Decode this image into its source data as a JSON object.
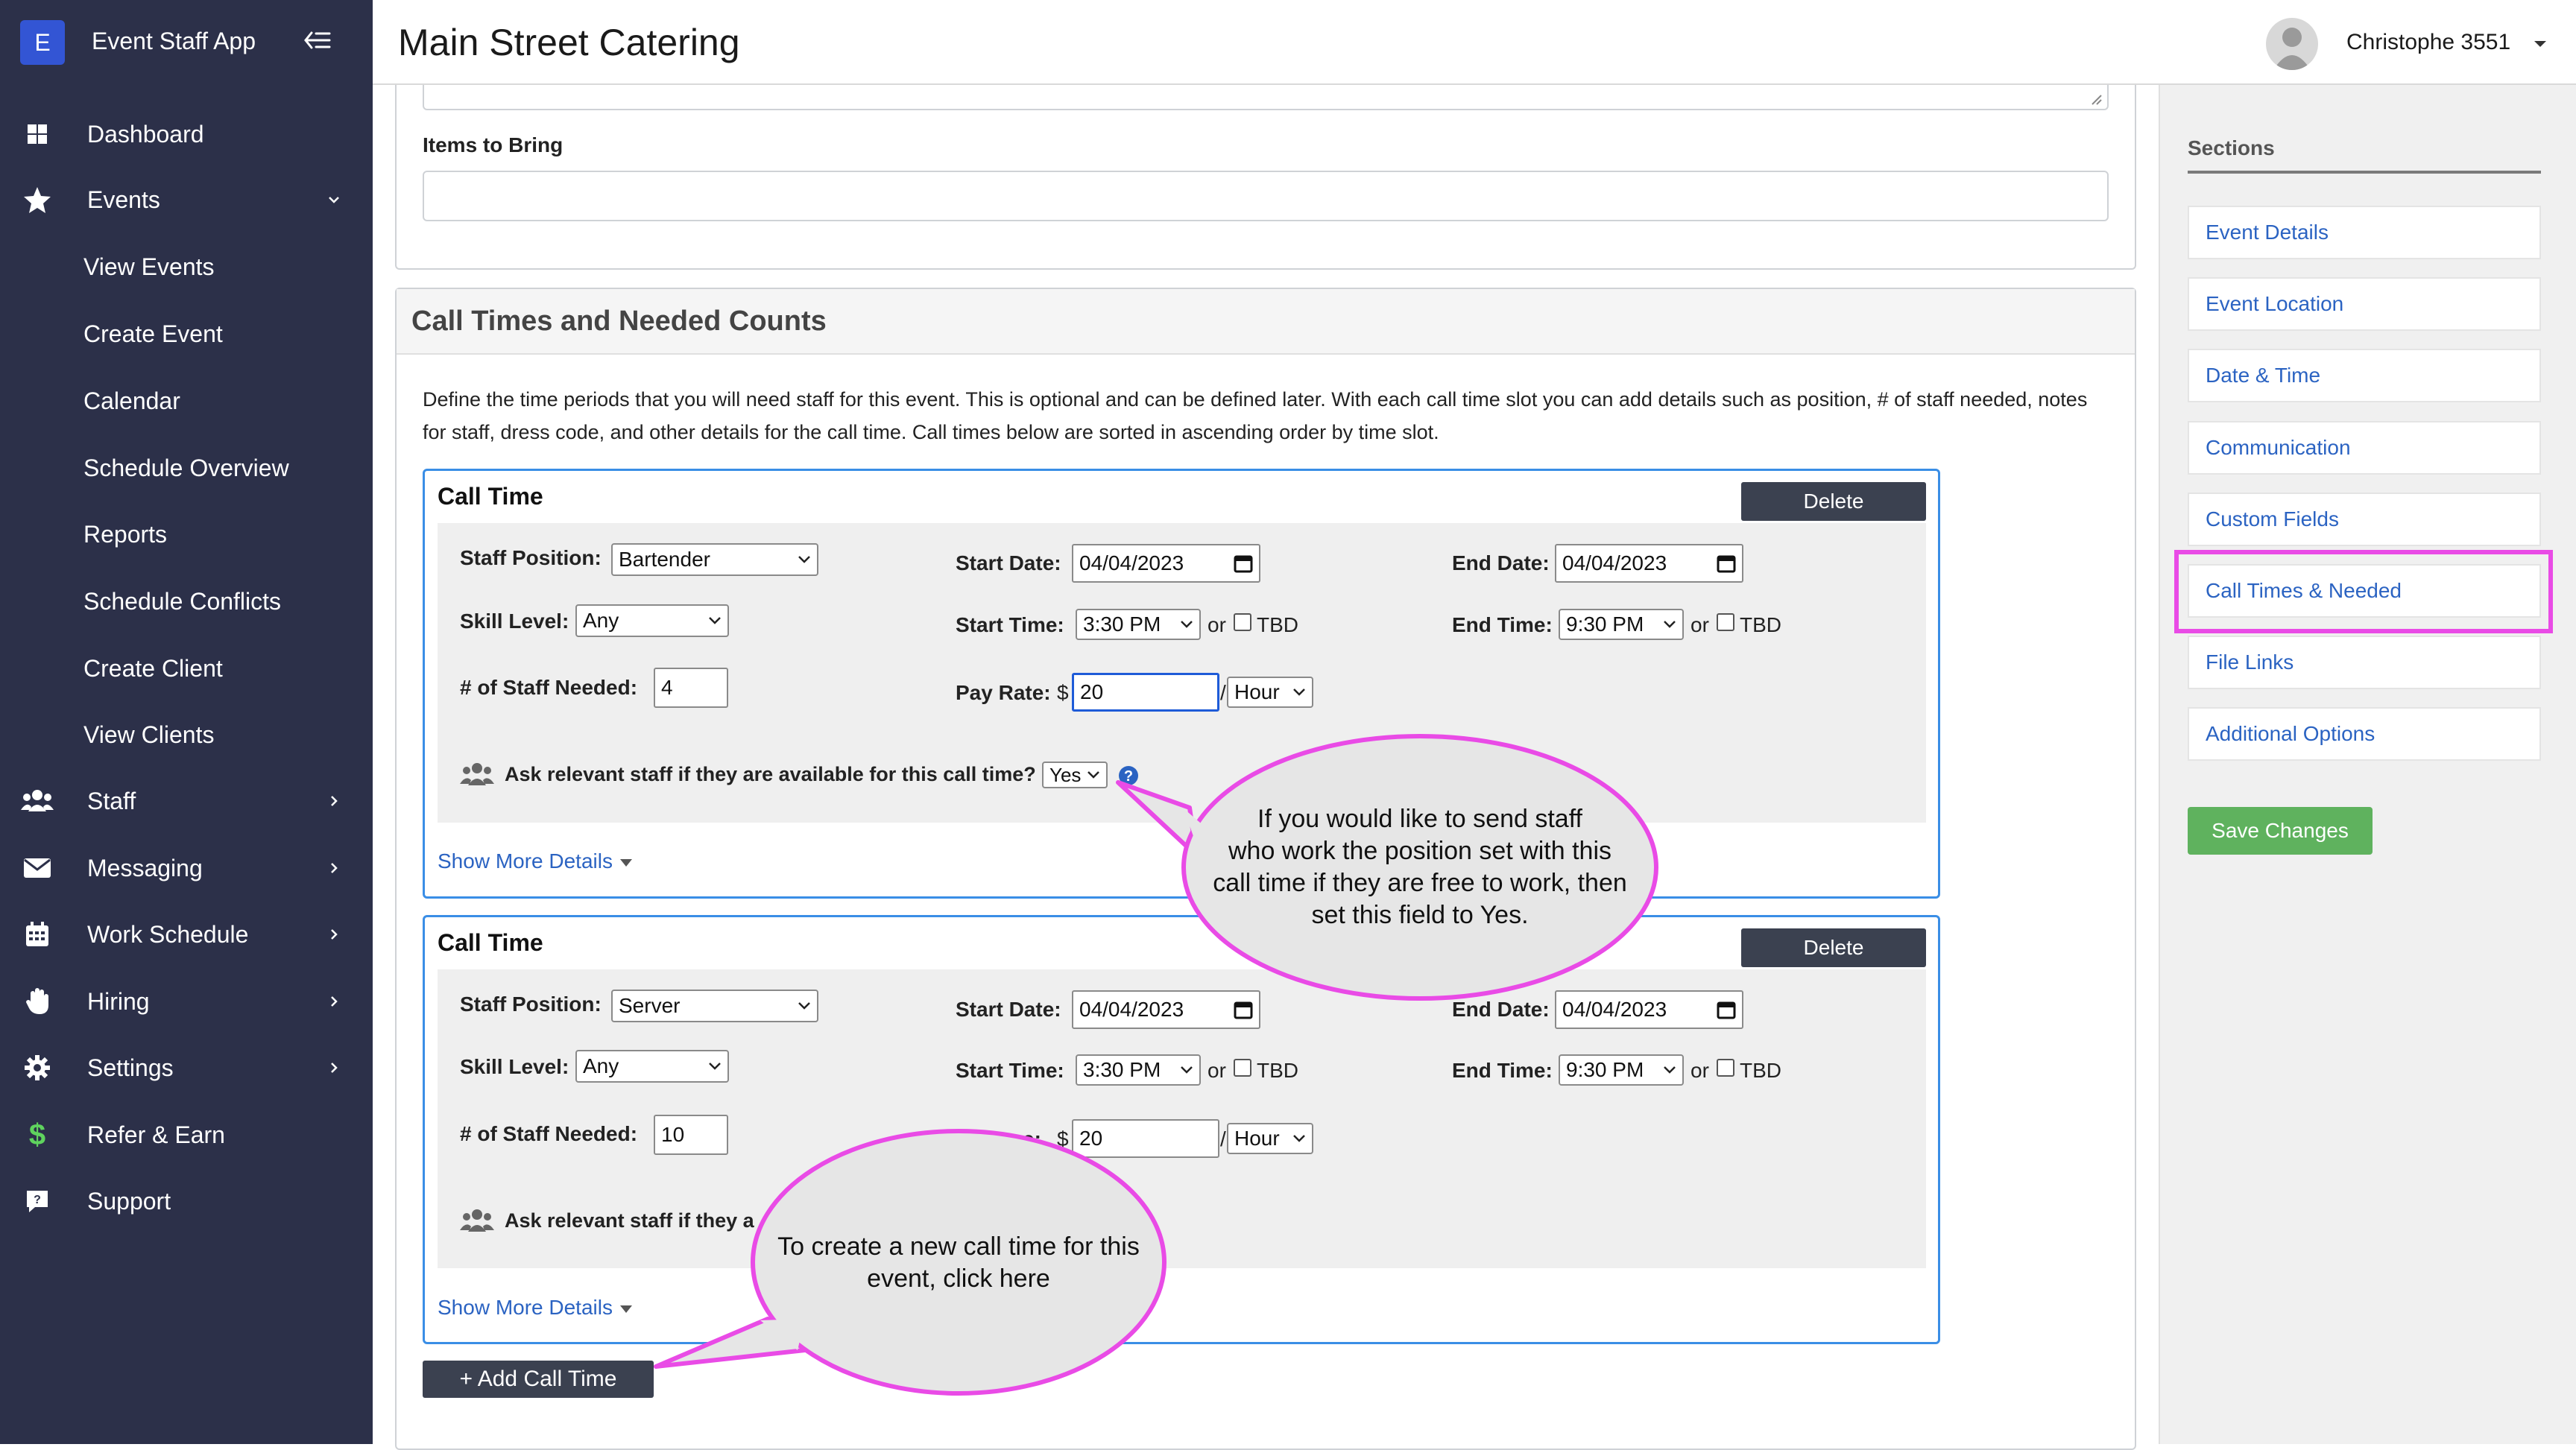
{
  "app": {
    "logo_letter": "E",
    "name": "Event Staff App"
  },
  "sidebar": {
    "items": [
      {
        "label": "Dashboard",
        "icon": "dashboard-icon"
      },
      {
        "label": "Events",
        "icon": "star-icon"
      },
      {
        "label": "Staff",
        "icon": "users-icon"
      },
      {
        "label": "Messaging",
        "icon": "envelope-icon"
      },
      {
        "label": "Work Schedule",
        "icon": "calendar-icon"
      },
      {
        "label": "Hiring",
        "icon": "hand-icon"
      },
      {
        "label": "Settings",
        "icon": "gear-icon"
      },
      {
        "label": "Refer & Earn",
        "icon": "dollar-icon"
      },
      {
        "label": "Support",
        "icon": "support-icon"
      }
    ],
    "events_sub": [
      "View Events",
      "Create Event",
      "Calendar",
      "Schedule Overview",
      "Reports",
      "Schedule Conflicts",
      "Create Client",
      "View Clients"
    ]
  },
  "header": {
    "title": "Main Street Catering",
    "user": "Christophe 3551"
  },
  "items_to_bring": {
    "label": "Items to Bring",
    "value": ""
  },
  "call_times": {
    "title": "Call Times and Needed Counts",
    "description": "Define the time periods that you will need staff for this event. This is optional and can be defined later. With each call time slot you can add details such as position, # of staff needed, notes for staff, dress code, and other details for the call time. Call times below are sorted in ascending order by time slot.",
    "labels": {
      "card_title": "Call Time",
      "delete": "Delete",
      "staff_position": "Staff Position:",
      "skill_level": "Skill Level:",
      "staff_needed": "# of Staff Needed:",
      "start_date": "Start Date:",
      "end_date": "End Date:",
      "start_time": "Start Time:",
      "end_time": "End Time:",
      "pay_rate": "Pay Rate:",
      "dollar": "$",
      "slash": "/",
      "or": "or",
      "tbd": "TBD",
      "ask_staff": "Ask relevant staff if they are available for this call time?",
      "ask_staff_partial": "Ask relevant staff if they a",
      "pay_rate_partial": "e:",
      "show_more": "Show More Details"
    },
    "slots": [
      {
        "staff_position": "Bartender",
        "skill_level": "Any",
        "staff_needed": "4",
        "start_date": "04/04/2023",
        "end_date": "04/04/2023",
        "start_time": "3:30 PM",
        "end_time": "9:30 PM",
        "pay_rate": "20",
        "pay_unit": "Hour",
        "ask_staff": "Yes"
      },
      {
        "staff_position": "Server",
        "skill_level": "Any",
        "staff_needed": "10",
        "start_date": "04/04/2023",
        "end_date": "04/04/2023",
        "start_time": "3:30 PM",
        "end_time": "9:30 PM",
        "pay_rate": "20",
        "pay_unit": "Hour"
      }
    ],
    "add_button": "+ Add Call Time"
  },
  "callouts": {
    "ask_staff_lines": [
      "If you would like to send staff",
      "who work the position set with this",
      "call time if they are free to work, then",
      "set this field to Yes."
    ],
    "add_call_time_lines": [
      "To create a new call time for this",
      "event, click here"
    ]
  },
  "sections": {
    "title": "Sections",
    "items": [
      "Event Details",
      "Event Location",
      "Date & Time",
      "Communication",
      "Custom Fields",
      "Call Times & Needed",
      "File Links",
      "Additional Options"
    ],
    "save": "Save Changes"
  },
  "colors": {
    "sidebar_bg": "#2c3049",
    "accent_blue": "#3a8ee6",
    "link_blue": "#2b63c2",
    "highlight_magenta": "#e94be6",
    "save_green": "#5fb25e",
    "dark_button": "#3b4150"
  }
}
